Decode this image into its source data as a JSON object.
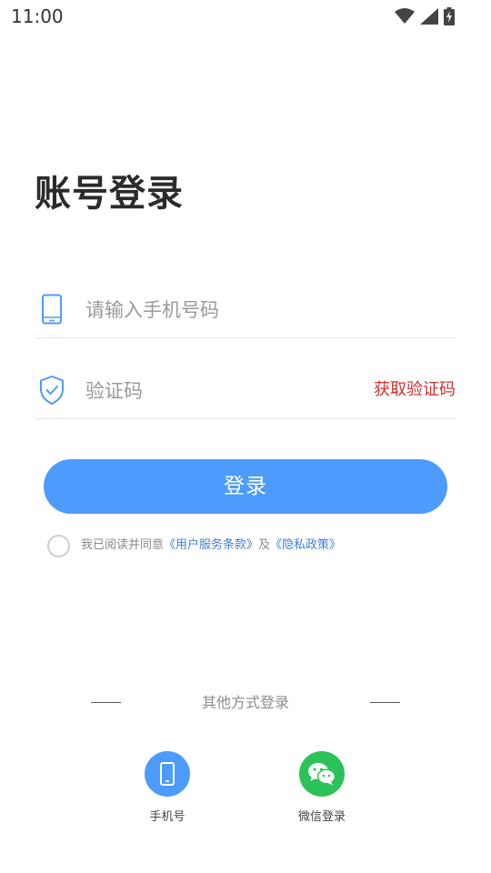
{
  "status_bar": {
    "time": "11:00",
    "icons": [
      "wifi-icon",
      "cellular-signal-icon",
      "battery-charging-icon"
    ]
  },
  "title": "账号登录",
  "phone_field": {
    "placeholder": "请输入手机号码",
    "value": "",
    "icon": "phone-icon"
  },
  "code_field": {
    "placeholder": "验证码",
    "value": "",
    "icon": "shield-check-icon",
    "get_code_label": "获取验证码"
  },
  "login_button": "登录",
  "agreement": {
    "checked": false,
    "prefix": "我已阅读并同意",
    "terms_link": "《用户服务条款》",
    "conjunction": "及",
    "privacy_link": "《隐私政策》"
  },
  "other_login": {
    "divider_text": "其他方式登录",
    "options": [
      {
        "label": "手机号",
        "icon": "mobile-phone-icon",
        "color": "#4d9bfd"
      },
      {
        "label": "微信登录",
        "icon": "wechat-icon",
        "color": "#2bc25a"
      }
    ]
  },
  "colors": {
    "primary": "#4d9bfd",
    "accent_red": "#d6302b",
    "link": "#3f7fd8",
    "wechat_green": "#2bc25a"
  }
}
